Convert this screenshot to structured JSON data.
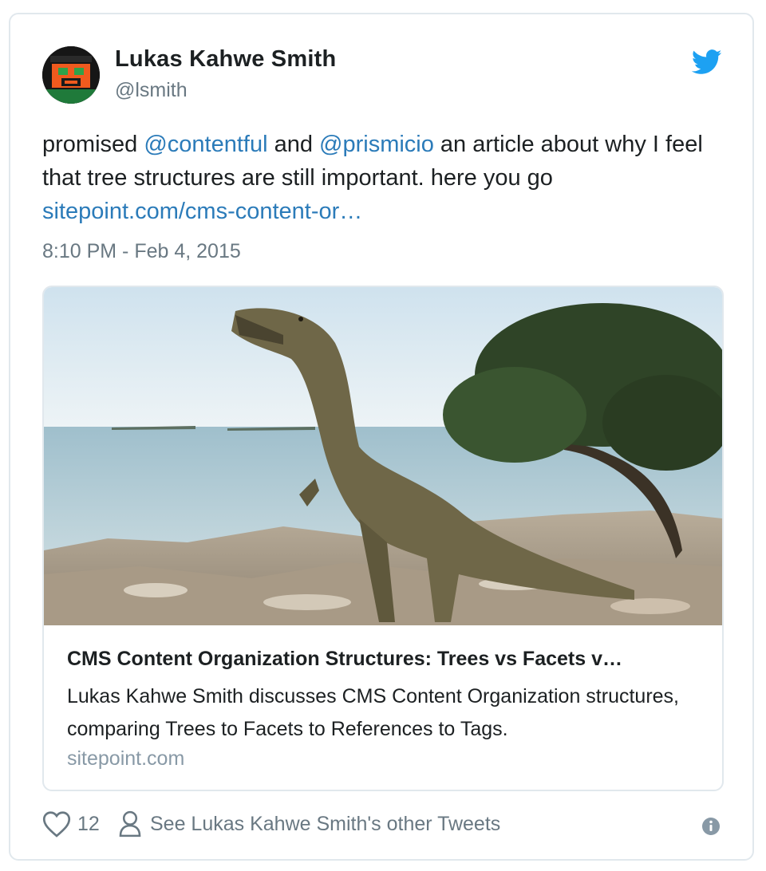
{
  "author": {
    "name": "Lukas Kahwe Smith",
    "handle": "@lsmith"
  },
  "tweet": {
    "text_1": "promised ",
    "mention_1": "@contentful",
    "text_2": " and ",
    "mention_2": "@prismicio",
    "text_3": " an article about why I feel that tree structures are still important. here you go",
    "link": "sitepoint.com/cms-content-or…",
    "timestamp": "8:10 PM - Feb 4, 2015"
  },
  "card": {
    "image_alt": "dinosaur statue on a rocky shoreline",
    "title": "CMS Content Organization Structures: Trees vs Facets v…",
    "description": "Lukas Kahwe Smith discusses CMS Content Organization structures, comparing Trees to Facets to References to Tags.",
    "domain": "sitepoint.com"
  },
  "actions": {
    "like_count": "12",
    "profile_link": "See Lukas Kahwe Smith's other Tweets"
  },
  "icons": {
    "brand": "twitter-bird-icon",
    "like": "heart-icon",
    "profile": "person-icon",
    "info": "info-icon"
  },
  "colors": {
    "link": "#2b7bb9",
    "brand": "#1da1f2",
    "muted": "#697882",
    "border": "#e1e8ed"
  }
}
